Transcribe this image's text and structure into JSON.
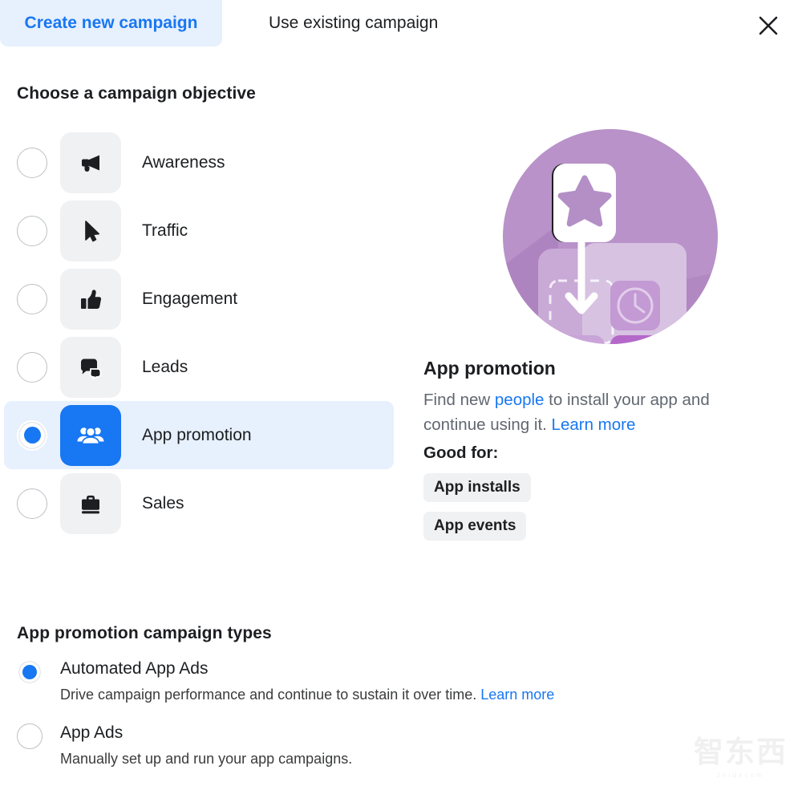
{
  "tabs": [
    {
      "label": "Create new campaign",
      "active": true
    },
    {
      "label": "Use existing campaign",
      "active": false
    }
  ],
  "close_icon": "close-icon",
  "objective_section": {
    "title": "Choose a campaign objective",
    "items": [
      {
        "label": "Awareness",
        "icon": "megaphone-icon",
        "selected": false
      },
      {
        "label": "Traffic",
        "icon": "cursor-icon",
        "selected": false
      },
      {
        "label": "Engagement",
        "icon": "thumbs-up-icon",
        "selected": false
      },
      {
        "label": "Leads",
        "icon": "chat-bubbles-icon",
        "selected": false
      },
      {
        "label": "App promotion",
        "icon": "people-icon",
        "selected": true
      },
      {
        "label": "Sales",
        "icon": "briefcase-icon",
        "selected": false
      }
    ]
  },
  "detail": {
    "illustration": "app-promotion-illustration",
    "title": "App promotion",
    "desc_part1": "Find new ",
    "desc_highlight": "people",
    "desc_part2": " to install your app and continue using it. ",
    "desc_link": "Learn more",
    "good_for_label": "Good for:",
    "chips": [
      "App installs",
      "App events"
    ]
  },
  "types_section": {
    "title": "App promotion campaign types",
    "items": [
      {
        "name": "Automated App Ads",
        "desc": "Drive campaign performance and continue to sustain it over time. ",
        "link": "Learn more",
        "selected": true
      },
      {
        "name": "App Ads",
        "desc": "Manually set up and run your app campaigns.",
        "link": "",
        "selected": false
      }
    ]
  },
  "watermark": {
    "main": "智东西",
    "sub": "zhidxcom"
  },
  "colors": {
    "accent": "#1877f2",
    "accent_bg": "#e7f0fd",
    "tile_bg": "#f0f1f3",
    "text": "#1c1e21",
    "muted": "#606770",
    "illustration_circle": "#b892c8"
  }
}
